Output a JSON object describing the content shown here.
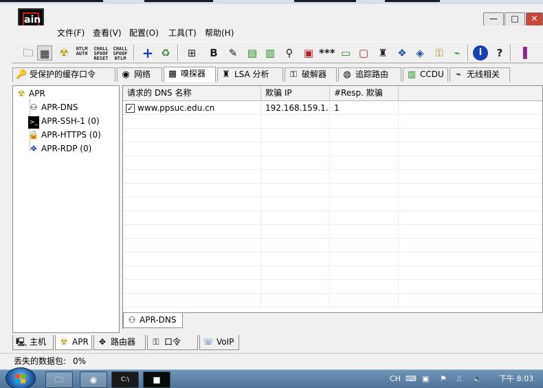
{
  "window": {
    "logo_text": "ain",
    "controls": {
      "minimize": "—",
      "maximize": "□",
      "close": "✕"
    }
  },
  "menu": [
    "文件(F)",
    "查看(V)",
    "配置(O)",
    "工具(T)",
    "帮助(H)"
  ],
  "toolbar": {
    "text_buttons": [
      {
        "lines": [
          "",
          "NTLM",
          "AUTH"
        ]
      },
      {
        "lines": [
          "CHALL",
          "SPOOF",
          "RESET"
        ]
      },
      {
        "lines": [
          "CHALL",
          "SPOOF",
          "NTLM"
        ]
      }
    ]
  },
  "feature_tabs": [
    {
      "label": "受保护的缓存口令",
      "icon": "key-icon"
    },
    {
      "label": "网络",
      "icon": "globe-icon"
    },
    {
      "label": "嗅探器",
      "icon": "network-card-icon"
    },
    {
      "label": "LSA 分析",
      "icon": "lsa-icon"
    },
    {
      "label": "破解器",
      "icon": "cracker-key-icon"
    },
    {
      "label": "追踪路由",
      "icon": "traceroute-icon"
    },
    {
      "label": "CCDU",
      "icon": "ccdu-chart-icon"
    },
    {
      "label": "无线相关",
      "icon": "wireless-icon"
    }
  ],
  "tree": {
    "root": {
      "label": "APR",
      "icon": "radiation-icon"
    },
    "children": [
      {
        "label": "APR-DNS",
        "icon": "network-icon"
      },
      {
        "label": "APR-SSH-1 (0)",
        "icon": "terminal-icon"
      },
      {
        "label": "APR-HTTPS (0)",
        "icon": "lock-icon"
      },
      {
        "label": "APR-RDP (0)",
        "icon": "remote-desktop-icon"
      }
    ]
  },
  "list": {
    "columns": [
      "请求的 DNS 名称",
      "欺骗 IP",
      "#Resp. 欺骗"
    ],
    "rows": [
      {
        "checked": true,
        "check_glyph": "✓",
        "cells": [
          "www.ppsuc.edu.cn",
          "192.168.159.1...",
          "1"
        ]
      }
    ]
  },
  "list_tab": {
    "label": "APR-DNS",
    "icon": "network-icon"
  },
  "bottom_tabs": [
    {
      "label": "主机",
      "icon": "computer-icon"
    },
    {
      "label": "APR",
      "icon": "radiation-icon",
      "active": true
    },
    {
      "label": "路由器",
      "icon": "router-icon"
    },
    {
      "label": "口令",
      "icon": "password-icon"
    },
    {
      "label": "VoIP",
      "icon": "voip-icon"
    }
  ],
  "status": {
    "label": "丢失的数据包:",
    "value": "0%"
  },
  "taskbar": {
    "tray": {
      "ime": "CH",
      "time": "下午 8:03"
    }
  },
  "colors": {
    "accent_red": "#d41a1a",
    "taskbar": "#5c81a5",
    "list_bg": "#ffffff"
  }
}
